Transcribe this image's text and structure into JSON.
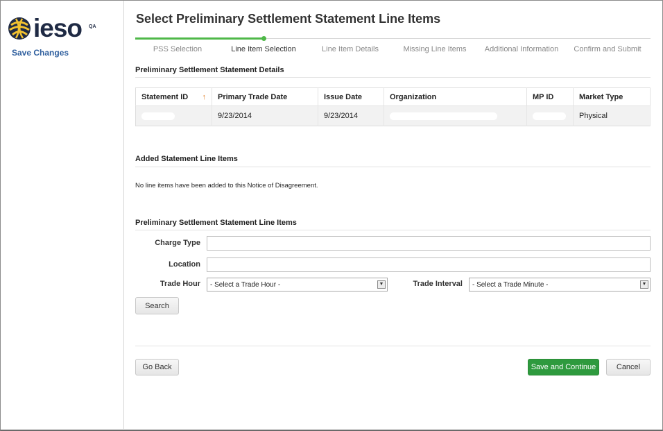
{
  "sidebar": {
    "logo_text": "ieso",
    "env_badge": "QA",
    "save_link": "Save Changes"
  },
  "page": {
    "title": "Select Preliminary Settlement Statement Line Items"
  },
  "stepper": {
    "steps": [
      "PSS Selection",
      "Line Item Selection",
      "Line Item Details",
      "Missing Line Items",
      "Additional Information",
      "Confirm and Submit"
    ],
    "current_step": 2
  },
  "details": {
    "title": "Preliminary Settlement Statement Details",
    "columns": [
      "Statement ID",
      "Primary Trade Date",
      "Issue Date",
      "Organization",
      "MP ID",
      "Market Type"
    ],
    "row": {
      "statement_id": "",
      "primary_trade_date": "9/23/2014",
      "issue_date": "9/23/2014",
      "organization": "",
      "mp_id": "",
      "market_type": "Physical"
    }
  },
  "added": {
    "title": "Added Statement Line Items",
    "empty_message": "No line items have been added to this Notice of Disagreement."
  },
  "search": {
    "title": "Preliminary Settlement Statement Line Items",
    "charge_type_label": "Charge Type",
    "charge_type_value": "",
    "location_label": "Location",
    "location_value": "",
    "trade_hour_label": "Trade Hour",
    "trade_hour_value": "- Select a Trade Hour -",
    "trade_interval_label": "Trade Interval",
    "trade_interval_value": "- Select a Trade Minute -",
    "search_button": "Search"
  },
  "actions": {
    "back_button": "Go Back",
    "save_continue_button": "Save and Continue",
    "cancel_button": "Cancel"
  },
  "colors": {
    "accent_green": "#4fb848",
    "primary_button": "#2e9a3e",
    "link_blue": "#2f5f9e",
    "sort_arrow": "#e07a1f"
  }
}
